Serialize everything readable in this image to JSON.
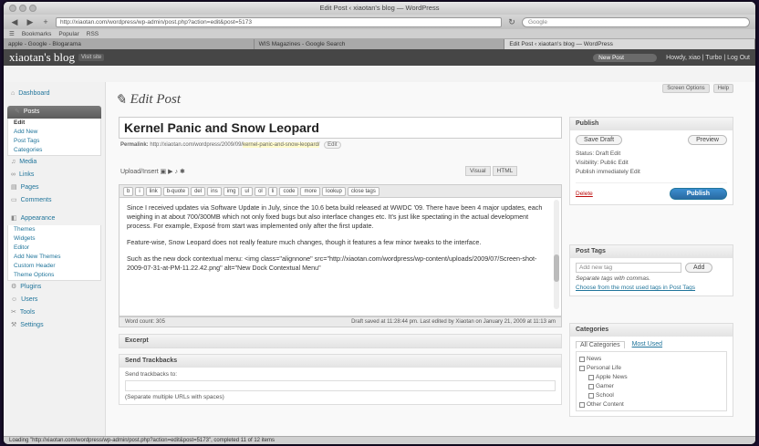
{
  "browser": {
    "window_title": "Edit Post ‹ xiaotan's blog — WordPress",
    "url": "http://xiaotan.com/wordpress/wp-admin/post.php?action=edit&post=5173",
    "search_placeholder": "Google",
    "bookmarks": [
      "Bookmarks",
      "Popular",
      "RSS"
    ],
    "tabs": [
      "apple - Google - Blogarama",
      "WIS Magazines - Google Search",
      "Edit Post ‹ xiaotan's blog — WordPress"
    ],
    "status": "Loading \"http://xiaotan.com/wordpress/wp-admin/post.php?action=edit&post=5173\", completed 11 of 12 items"
  },
  "wp": {
    "blog_name": "xiaotan's blog",
    "visit_site": "Visit site",
    "favorites": "New Post",
    "user_nav": "Howdy, xiao | Turbo | Log Out",
    "screen_options": "Screen Options",
    "help": "Help"
  },
  "sidebar": {
    "dashboard": "Dashboard",
    "posts": "Posts",
    "posts_sub": [
      "Edit",
      "Add New",
      "Post Tags",
      "Categories"
    ],
    "media": "Media",
    "links": "Links",
    "pages": "Pages",
    "comments": "Comments",
    "appearance": "Appearance",
    "appearance_sub": [
      "Themes",
      "Widgets",
      "Editor",
      "Add New Themes",
      "Custom Header",
      "Theme Options"
    ],
    "plugins": "Plugins",
    "users": "Users",
    "tools": "Tools",
    "settings": "Settings"
  },
  "post": {
    "page_title": "Edit Post",
    "title": "Kernel Panic and Snow Leopard",
    "permalink_label": "Permalink:",
    "permalink_base": "http://xiaotan.com/wordpress/2009/09/",
    "permalink_slug": "kernel-panic-and-snow-leopard/",
    "edit_label": "Edit",
    "upload_label": "Upload/Insert",
    "tab_visual": "Visual",
    "tab_html": "HTML",
    "quicktags": [
      "b",
      "i",
      "link",
      "b-quote",
      "del",
      "ins",
      "img",
      "ul",
      "ol",
      "li",
      "code",
      "more",
      "lookup",
      "close tags"
    ],
    "paragraph1": "Since I received updates via Software Update in July, since the 10.6 beta build released at WWDC '09. There have been 4 major updates, each weighing in at about 700/300MB which not only fixed bugs but also interface changes etc. It's just like spectating in the actual development process. For example, Exposé from start was implemented only after the first update.",
    "paragraph2": "Feature-wise, Snow Leopard does not really feature much changes, though it features a few minor tweaks to the interface.",
    "paragraph3": "Such as the new dock contextual menu: <img class=\"alignnone\" src=\"http://xiaotan.com/wordpress/wp-content/uploads/2009/07/Screen-shot-2009-07-31-at-PM-11.22.42.png\" alt=\"New Dock Contextual Menu\"",
    "word_count": "Word count: 305",
    "last_edited": "Draft saved at 11:28:44 pm. Last edited by Xiaotan on January 21, 2009 at 11:13 am",
    "excerpt_label": "Excerpt",
    "trackbacks_label": "Send Trackbacks",
    "trackbacks_to": "Send trackbacks to:",
    "trackbacks_hint": "(Separate multiple URLs with spaces)"
  },
  "publish": {
    "header": "Publish",
    "save_draft": "Save Draft",
    "preview": "Preview",
    "status": "Status: Draft Edit",
    "visibility": "Visibility: Public Edit",
    "schedule": "Publish immediately Edit",
    "delete": "Delete",
    "publish_button": "Publish"
  },
  "tags": {
    "header": "Post Tags",
    "placeholder": "Add new tag",
    "add_button": "Add",
    "hint": "Separate tags with commas.",
    "choose": "Choose from the most used tags in Post Tags"
  },
  "categories": {
    "header": "Categories",
    "tab_all": "All Categories",
    "tab_most": "Most Used",
    "items": [
      "News",
      "Personal Life",
      "Apple News",
      "Gamer",
      "School",
      "Other Content"
    ]
  }
}
